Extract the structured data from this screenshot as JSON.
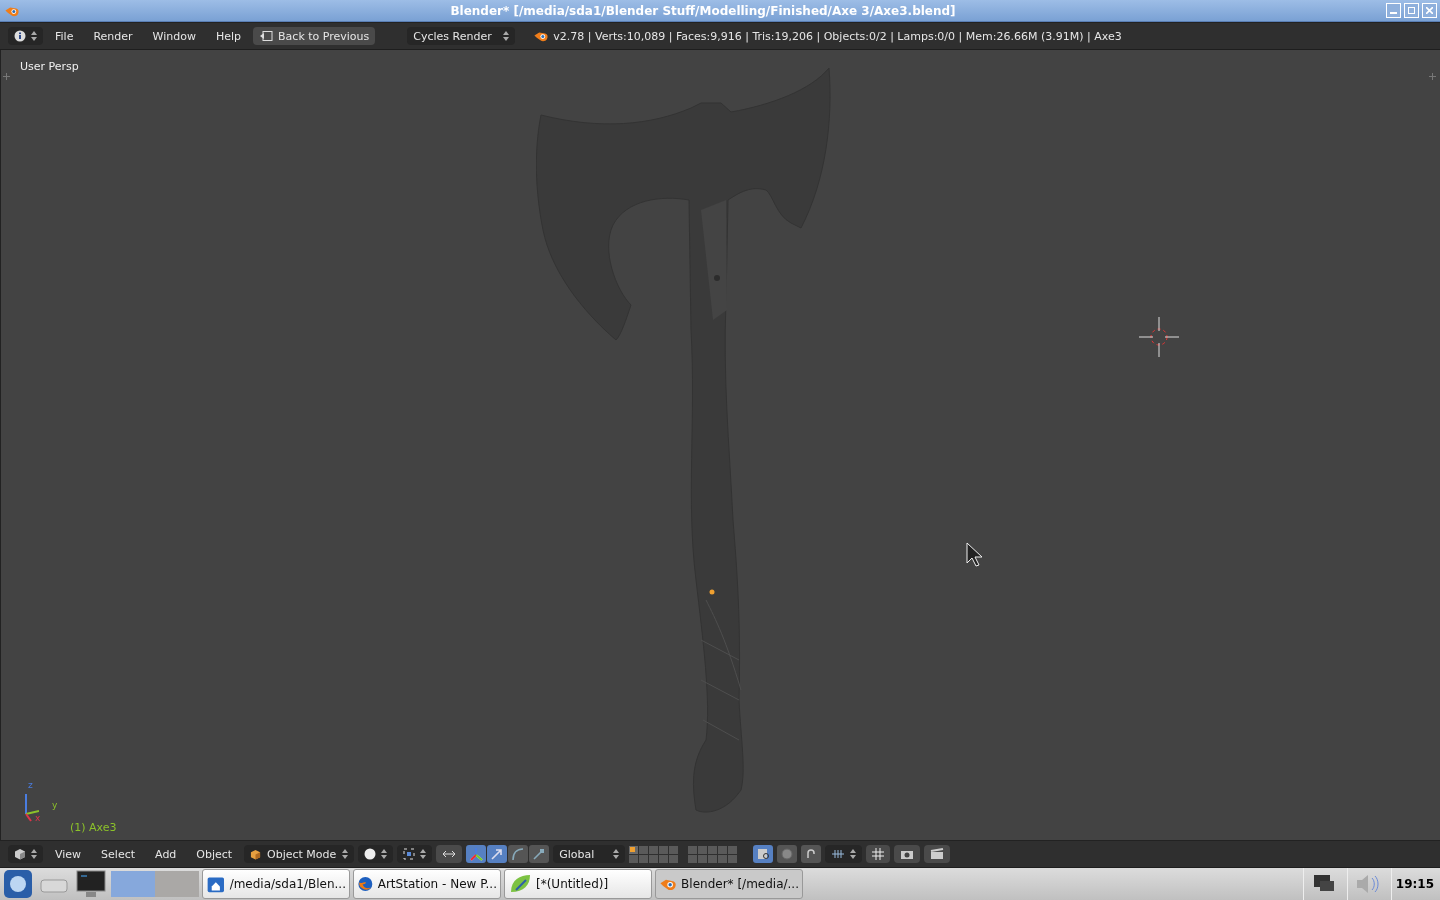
{
  "window": {
    "title": "Blender* [/media/sda1/Blender Stuff/Modelling/Finished/Axe 3/Axe3.blend]"
  },
  "info_header": {
    "menus": [
      "File",
      "Render",
      "Window",
      "Help"
    ],
    "back_button": "Back to Previous",
    "render_engine": "Cycles Render",
    "stats": "v2.78 | Verts:10,089 | Faces:9,916 | Tris:19,206 | Objects:0/2 | Lamps:0/0 | Mem:26.66M (3.91M) | Axe3"
  },
  "viewport": {
    "view_label": "User Persp",
    "object_label": "(1) Axe3",
    "axes": [
      "z",
      "y",
      "x"
    ]
  },
  "view3d_header": {
    "menus": [
      "View",
      "Select",
      "Add",
      "Object"
    ],
    "mode": "Object Mode",
    "orientation": "Global",
    "manipulators": [
      {
        "kind": "axes",
        "selected": true
      },
      {
        "kind": "translate",
        "selected": true
      },
      {
        "kind": "rotate",
        "selected": false
      },
      {
        "kind": "scale",
        "selected": false
      }
    ],
    "layers": [
      {
        "selected": true
      },
      {
        "selected": false
      },
      {
        "selected": false
      },
      {
        "selected": false
      },
      {
        "selected": false
      },
      {
        "selected": false
      },
      {
        "selected": false
      },
      {
        "selected": false
      },
      {
        "selected": false
      },
      {
        "selected": false
      },
      {
        "selected": false
      },
      {
        "selected": false
      },
      {
        "selected": false
      },
      {
        "selected": false
      },
      {
        "selected": false
      },
      {
        "selected": false
      },
      {
        "selected": false
      },
      {
        "selected": false
      },
      {
        "selected": false
      },
      {
        "selected": false
      }
    ]
  },
  "taskbar": {
    "workspaces": [
      {
        "selected": true
      },
      {
        "selected": false
      }
    ],
    "tasks": [
      {
        "kind": "folder",
        "label": "/media/sda1/Blen...",
        "selected": false
      },
      {
        "kind": "browser",
        "label": "ArtStation - New P...",
        "selected": false
      },
      {
        "kind": "editor",
        "label": "[*(Untitled)]",
        "selected": false
      },
      {
        "kind": "blender",
        "label": "Blender* [/media/...",
        "selected": true
      }
    ],
    "clock": "19:15"
  }
}
